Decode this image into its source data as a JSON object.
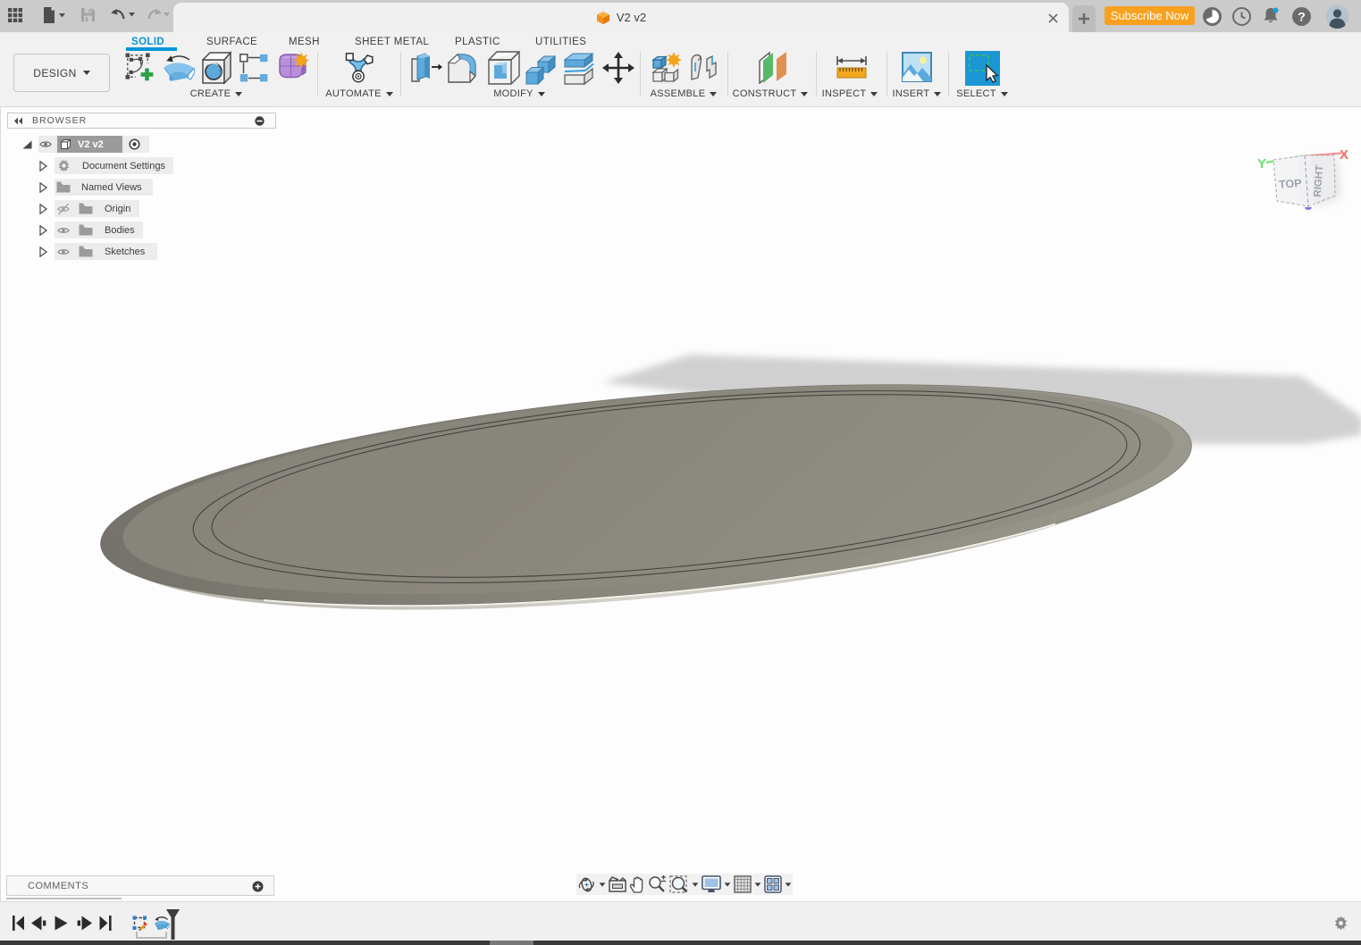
{
  "topbar": {
    "tab_title": "V2 v2",
    "subscribe_label": "Subscribe Now",
    "close_tab_glyph": "×",
    "new_tab_glyph": "+",
    "icons": [
      "grid-menu",
      "file-new",
      "save",
      "undo",
      "redo",
      "job-status",
      "recent",
      "notifications",
      "help",
      "avatar"
    ]
  },
  "ribbon": {
    "workspace_label": "DESIGN",
    "tabs": [
      {
        "label": "SOLID",
        "active": true
      },
      {
        "label": "SURFACE",
        "active": false
      },
      {
        "label": "MESH",
        "active": false
      },
      {
        "label": "SHEET METAL",
        "active": false
      },
      {
        "label": "PLASTIC",
        "active": false
      },
      {
        "label": "UTILITIES",
        "active": false
      }
    ],
    "groups": [
      {
        "label": "CREATE",
        "tools": [
          "create-sketch",
          "revolve",
          "hole",
          "pattern",
          "create-form"
        ]
      },
      {
        "label": "AUTOMATE",
        "tools": [
          "automated-modeling"
        ]
      },
      {
        "label": "MODIFY",
        "tools": [
          "press-pull",
          "fillet",
          "shell",
          "combine",
          "offset-face",
          "move-copy"
        ]
      },
      {
        "label": "ASSEMBLE",
        "tools": [
          "new-component",
          "joint"
        ]
      },
      {
        "label": "CONSTRUCT",
        "tools": [
          "construction-plane"
        ]
      },
      {
        "label": "INSPECT",
        "tools": [
          "measure"
        ]
      },
      {
        "label": "INSERT",
        "tools": [
          "insert-image"
        ]
      },
      {
        "label": "SELECT",
        "tools": [
          "select"
        ]
      }
    ],
    "accent_color": "#0696d7"
  },
  "browser": {
    "title": "BROWSER",
    "root": {
      "label": "V2 v2",
      "selected": true
    },
    "items": [
      {
        "label": "Document Settings",
        "icon": "gear",
        "eye": "none"
      },
      {
        "label": "Named Views",
        "icon": "folder",
        "eye": "none"
      },
      {
        "label": "Origin",
        "icon": "folder",
        "eye": "hidden"
      },
      {
        "label": "Bodies",
        "icon": "folder",
        "eye": "visible"
      },
      {
        "label": "Sketches",
        "icon": "folder",
        "eye": "visible"
      }
    ]
  },
  "viewcube": {
    "top_label": "TOP",
    "right_label": "RIGHT",
    "axis_x": "X",
    "axis_y": "Y",
    "axis_x_color": "#f26a5f",
    "axis_y_color": "#6ee26e"
  },
  "canvas": {
    "model": "flat elliptical plate body, olive-gray, viewed near edge-on",
    "body_color": "#8b887e",
    "shadow_color": "#c9c9c9"
  },
  "comments": {
    "label": "COMMENTS"
  },
  "navbar": {
    "icons": [
      "orbit",
      "look-at",
      "pan",
      "zoom",
      "fit",
      "display-settings",
      "grid-snaps",
      "viewports"
    ]
  },
  "timeline": {
    "playback": [
      "go-to-start",
      "step-back",
      "play",
      "step-forward",
      "go-to-end"
    ],
    "features": [
      "sketch-feature",
      "revolve-feature"
    ],
    "settings_icon": "gear"
  }
}
